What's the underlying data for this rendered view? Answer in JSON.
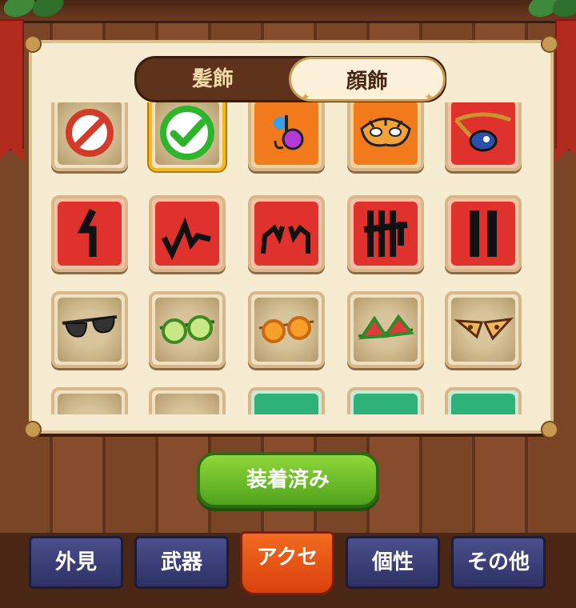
{
  "top_tabs": {
    "hair": "髪飾",
    "face": "顔飾",
    "active": "face"
  },
  "grid": [
    {
      "kind": "tan",
      "icon": "none-icon",
      "selected": false
    },
    {
      "kind": "tan",
      "icon": "checkmark-icon",
      "selected": true
    },
    {
      "kind": "orange",
      "icon": "music-note-glasses-icon",
      "selected": false
    },
    {
      "kind": "orange",
      "icon": "tiger-mask-icon",
      "selected": false
    },
    {
      "kind": "red",
      "icon": "eyepatch-icon",
      "selected": false
    },
    {
      "kind": "red",
      "icon": "face-paint-1-icon",
      "selected": false
    },
    {
      "kind": "red",
      "icon": "face-paint-2-icon",
      "selected": false
    },
    {
      "kind": "red",
      "icon": "face-paint-3-icon",
      "selected": false
    },
    {
      "kind": "red",
      "icon": "face-paint-4-icon",
      "selected": false
    },
    {
      "kind": "red",
      "icon": "face-paint-5-icon",
      "selected": false
    },
    {
      "kind": "tan",
      "icon": "sunglasses-icon",
      "selected": false
    },
    {
      "kind": "tan",
      "icon": "cucumber-glasses-icon",
      "selected": false
    },
    {
      "kind": "tan",
      "icon": "orange-glasses-icon",
      "selected": false
    },
    {
      "kind": "tan",
      "icon": "watermelon-glasses-icon",
      "selected": false
    },
    {
      "kind": "tan",
      "icon": "leopard-glasses-icon",
      "selected": false
    },
    {
      "kind": "tan",
      "icon": "item-icon",
      "selected": false
    },
    {
      "kind": "tan",
      "icon": "item-icon",
      "selected": false
    },
    {
      "kind": "green",
      "icon": "item-icon",
      "selected": false
    },
    {
      "kind": "green",
      "icon": "item-icon",
      "selected": false
    },
    {
      "kind": "green",
      "icon": "item-icon",
      "selected": false
    }
  ],
  "equip_button": "装着済み",
  "nav": [
    {
      "label": "外見",
      "active": false
    },
    {
      "label": "武器",
      "active": false
    },
    {
      "label": "アクセ",
      "active": true
    },
    {
      "label": "個性",
      "active": false
    },
    {
      "label": "その他",
      "active": false
    }
  ]
}
